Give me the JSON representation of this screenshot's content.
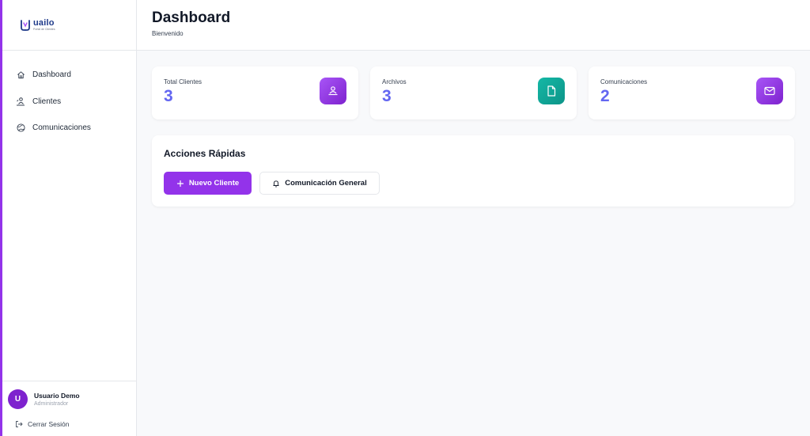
{
  "brand": {
    "name": "uailo",
    "tagline": "Portal de Clientes",
    "accent": "#9333ea"
  },
  "sidebar": {
    "items": [
      {
        "label": "Dashboard",
        "icon": "home-icon"
      },
      {
        "label": "Clientes",
        "icon": "users-icon"
      },
      {
        "label": "Comunicaciones",
        "icon": "globe-icon"
      }
    ]
  },
  "user": {
    "initial": "U",
    "name": "Usuario Demo",
    "role": "Administrador",
    "logout_label": "Cerrar Sesión"
  },
  "header": {
    "title": "Dashboard",
    "subtitle": "Bienvenido"
  },
  "stats": [
    {
      "label": "Total Clientes",
      "value": "3",
      "icon": "users-icon",
      "color": "#9333ea"
    },
    {
      "label": "Archivos",
      "value": "3",
      "icon": "file-icon",
      "color": "#14a38b"
    },
    {
      "label": "Comunicaciones",
      "value": "2",
      "icon": "mail-icon",
      "color": "#9333ea"
    }
  ],
  "actions": {
    "title": "Acciones Rápidas",
    "new_client_label": "Nuevo Cliente",
    "general_comm_label": "Comunicación General"
  }
}
